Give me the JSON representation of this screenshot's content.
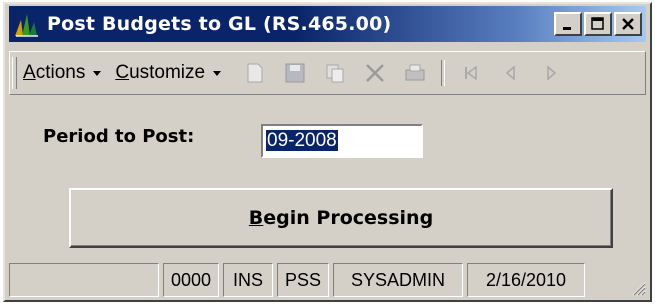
{
  "window": {
    "title": "Post Budgets to GL (RS.465.00)",
    "icon": "app-bars-icon",
    "controls": [
      "minimize-icon",
      "maximize-icon",
      "close-icon"
    ]
  },
  "toolbar": {
    "menus": [
      {
        "label": "Actions",
        "mnemonic": "A"
      },
      {
        "label": "Customize",
        "mnemonic": "C"
      }
    ],
    "icons": [
      "new-record-icon",
      "save-icon",
      "copy-icon",
      "delete-icon",
      "print-icon",
      "first-record-icon",
      "previous-record-icon",
      "next-record-icon"
    ]
  },
  "form": {
    "period_label": "Period to Post:",
    "period_value": "09-2008"
  },
  "actions": {
    "begin_label": "Begin Processing",
    "begin_mnemonic": "B"
  },
  "statusbar": {
    "panes": [
      "",
      "0000",
      "INS",
      "PSS",
      "SYSADMIN",
      "2/16/2010"
    ]
  },
  "colors": {
    "title_active": "#0a246a",
    "face": "#d4d0c8",
    "selection": "#0a246a"
  }
}
